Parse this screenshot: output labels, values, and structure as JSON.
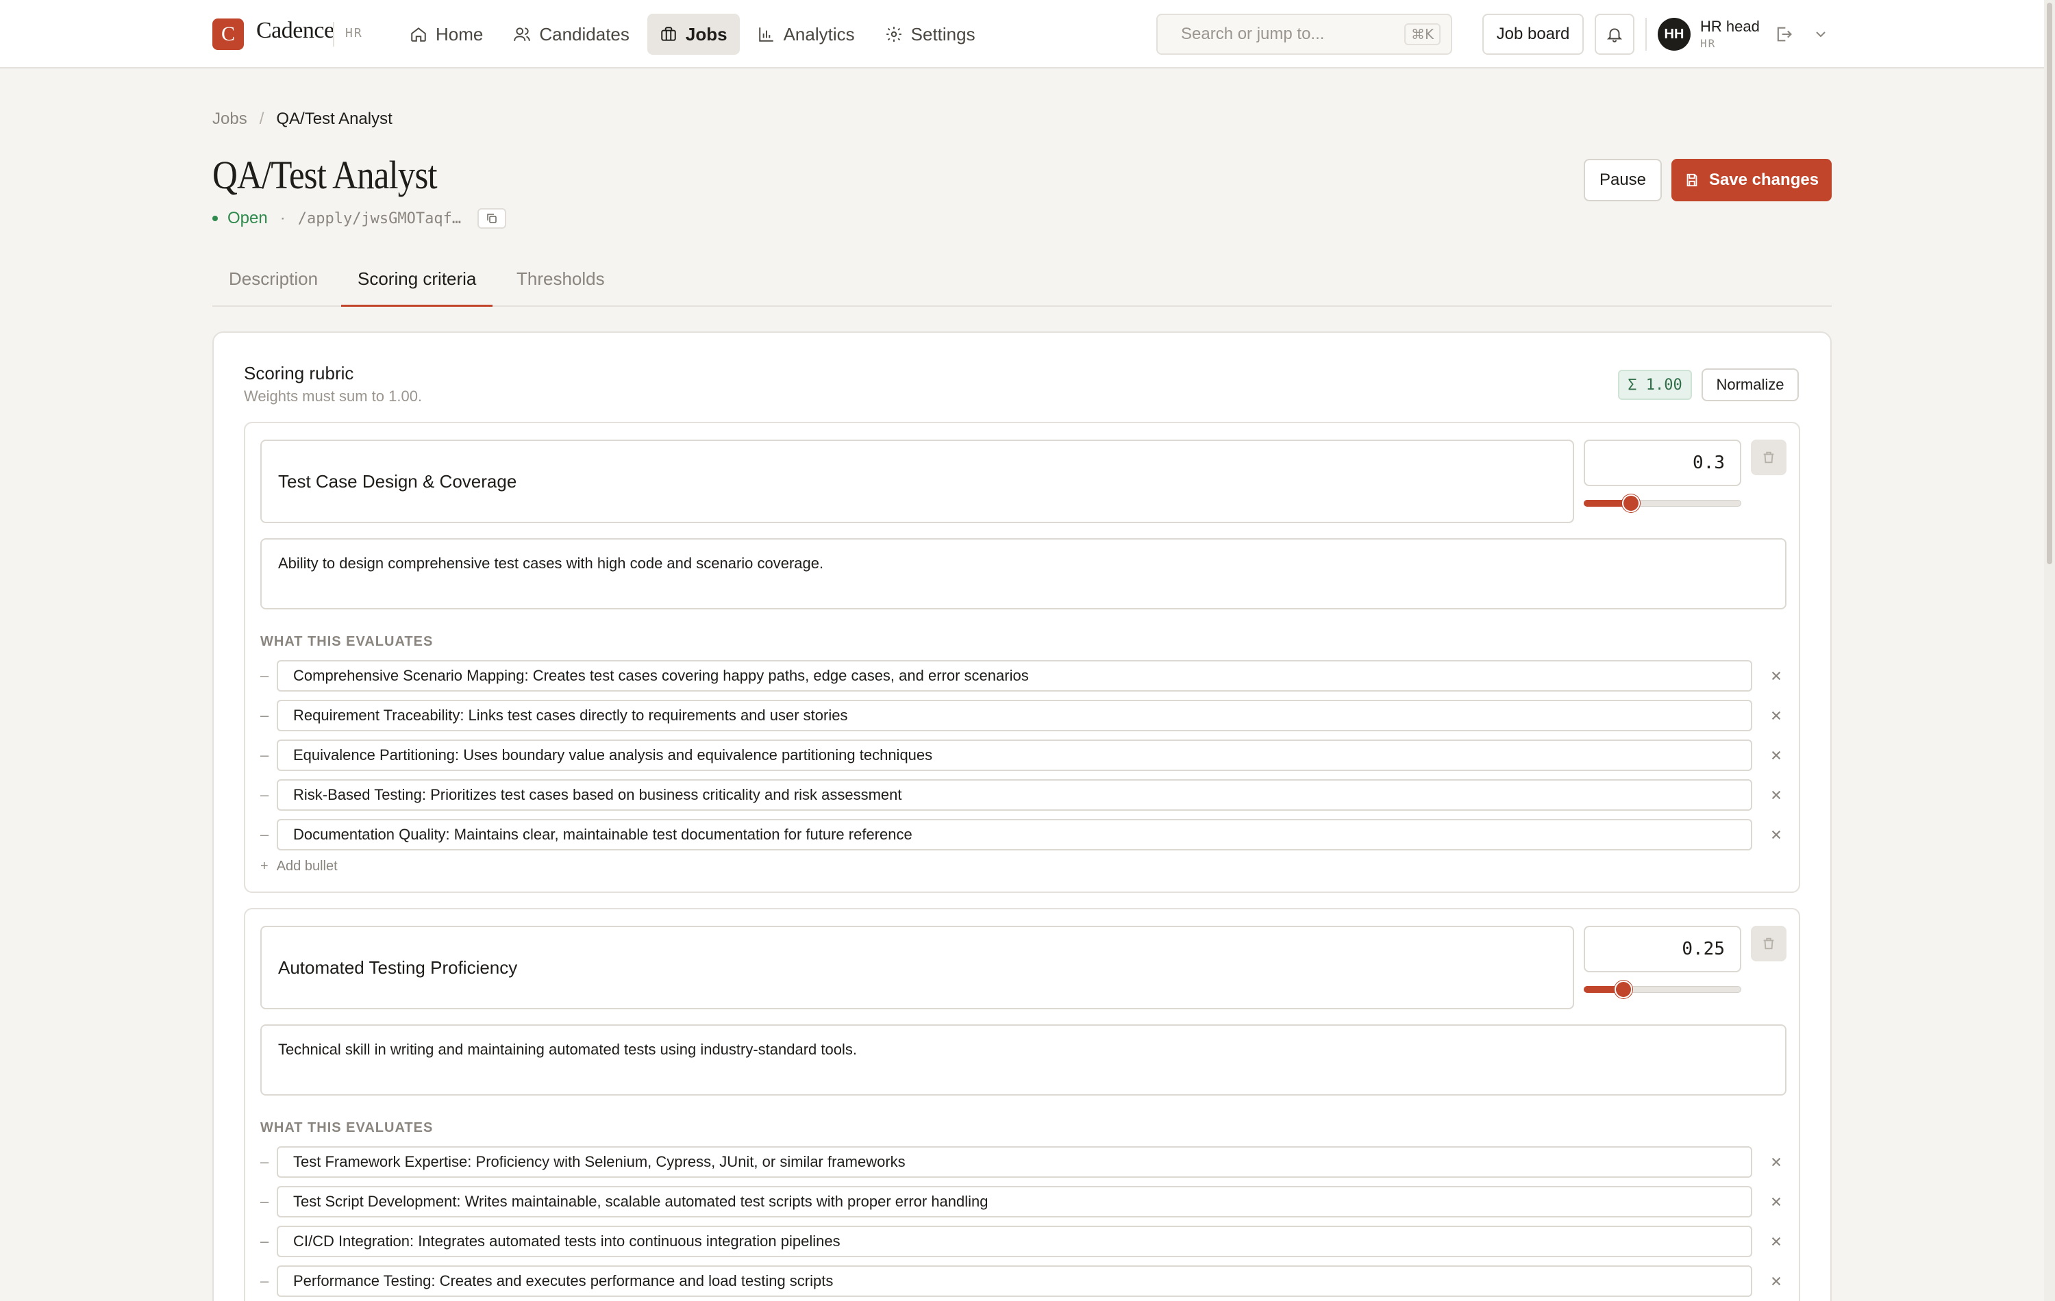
{
  "app": {
    "name": "Cadence",
    "logo_letter": "C",
    "section": "HR"
  },
  "nav": [
    {
      "label": "Home",
      "icon": "home-icon"
    },
    {
      "label": "Candidates",
      "icon": "users-icon"
    },
    {
      "label": "Jobs",
      "icon": "briefcase-icon",
      "active": true
    },
    {
      "label": "Analytics",
      "icon": "bar-chart-icon"
    },
    {
      "label": "Settings",
      "icon": "gear-icon"
    }
  ],
  "search": {
    "placeholder": "Search or jump to...",
    "shortcut": "⌘K"
  },
  "topbar": {
    "job_board": "Job board",
    "user_initials": "HH",
    "user_name": "HR head",
    "user_role": "HR"
  },
  "breadcrumb": {
    "parent": "Jobs",
    "separator": "/",
    "current": "QA/Test Analyst"
  },
  "job": {
    "title": "QA/Test Analyst",
    "status": "Open",
    "separator": "·",
    "apply_path": "/apply/jwsGMOTaqf…"
  },
  "actions": {
    "pause": "Pause",
    "save": "Save changes"
  },
  "tabs": [
    "Description",
    "Scoring criteria",
    "Thresholds"
  ],
  "active_tab": "Scoring criteria",
  "rubric": {
    "title": "Scoring rubric",
    "subtitle": "Weights must sum to 1.00.",
    "sum": "Σ 1.00",
    "normalize": "Normalize",
    "evaluates_label": "WHAT THIS EVALUATES",
    "add_bullet": "Add bullet",
    "criteria": [
      {
        "name": "Test Case Design & Coverage",
        "weight": "0.3",
        "weight_fraction": 0.3,
        "description": "Ability to design comprehensive test cases with high code and scenario coverage.",
        "bullets": [
          "Comprehensive Scenario Mapping: Creates test cases covering happy paths, edge cases, and error scenarios",
          "Requirement Traceability: Links test cases directly to requirements and user stories",
          "Equivalence Partitioning: Uses boundary value analysis and equivalence partitioning techniques",
          "Risk-Based Testing: Prioritizes test cases based on business criticality and risk assessment",
          "Documentation Quality: Maintains clear, maintainable test documentation for future reference"
        ]
      },
      {
        "name": "Automated Testing Proficiency",
        "weight": "0.25",
        "weight_fraction": 0.25,
        "description": "Technical skill in writing and maintaining automated tests using industry-standard tools.",
        "bullets": [
          "Test Framework Expertise: Proficiency with Selenium, Cypress, JUnit, or similar frameworks",
          "Test Script Development: Writes maintainable, scalable automated test scripts with proper error handling",
          "CI/CD Integration: Integrates automated tests into continuous integration pipelines",
          "Performance Testing: Creates and executes performance and load testing scripts"
        ]
      }
    ]
  },
  "colors": {
    "accent": "#c0452b",
    "open_status": "#2f8a4d",
    "background": "#f5f4f1"
  }
}
